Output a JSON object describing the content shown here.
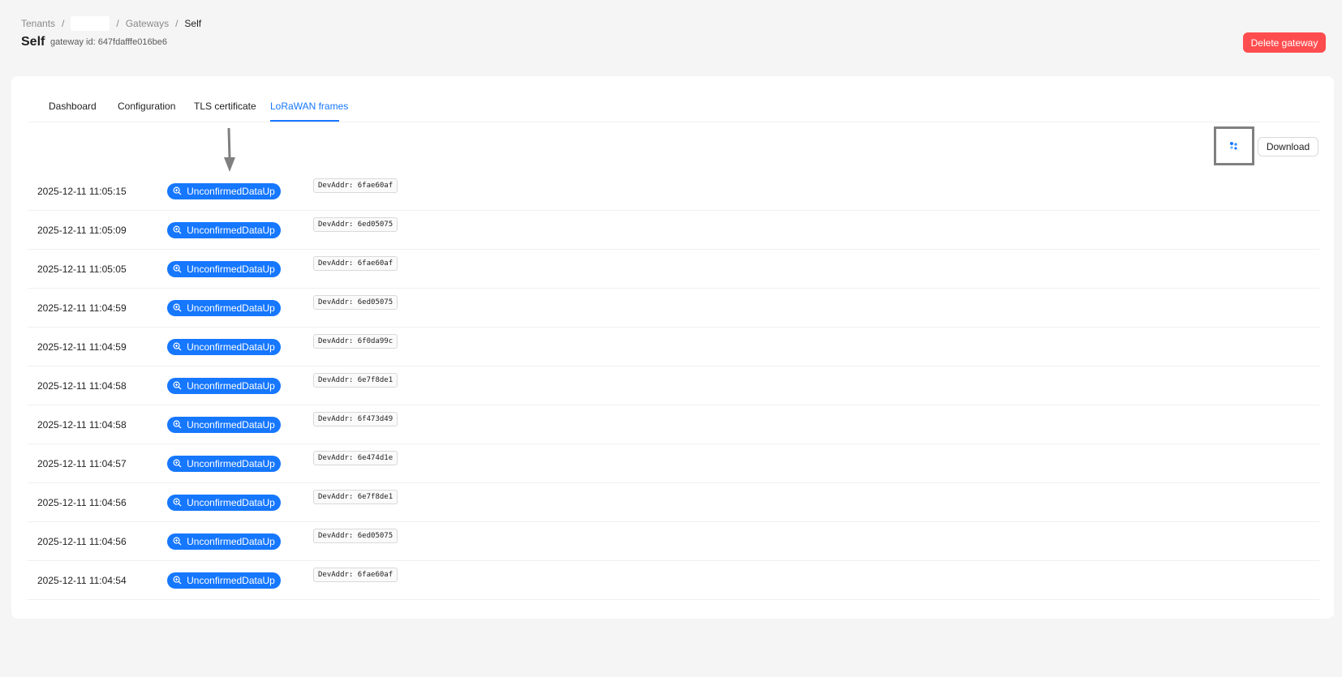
{
  "breadcrumb": {
    "items": [
      "Tenants",
      "",
      "Gateways",
      "Self"
    ],
    "separator": "/"
  },
  "header": {
    "title": "Self",
    "subtitle": "gateway id: 647fdafffe016be6",
    "delete_label": "Delete gateway"
  },
  "tabs": [
    {
      "label": "Dashboard",
      "active": false
    },
    {
      "label": "Configuration",
      "active": false
    },
    {
      "label": "TLS certificate",
      "active": false
    },
    {
      "label": "LoRaWAN frames",
      "active": true
    }
  ],
  "toolbar": {
    "refresh_icon": "loading-dots-icon",
    "download_label": "Download"
  },
  "frames": [
    {
      "time": "2025-12-11 11:05:15",
      "type": "UnconfirmedDataUp",
      "devaddr": "DevAddr: 6fae60af"
    },
    {
      "time": "2025-12-11 11:05:09",
      "type": "UnconfirmedDataUp",
      "devaddr": "DevAddr: 6ed05075"
    },
    {
      "time": "2025-12-11 11:05:05",
      "type": "UnconfirmedDataUp",
      "devaddr": "DevAddr: 6fae60af"
    },
    {
      "time": "2025-12-11 11:04:59",
      "type": "UnconfirmedDataUp",
      "devaddr": "DevAddr: 6ed05075"
    },
    {
      "time": "2025-12-11 11:04:59",
      "type": "UnconfirmedDataUp",
      "devaddr": "DevAddr: 6f0da99c"
    },
    {
      "time": "2025-12-11 11:04:58",
      "type": "UnconfirmedDataUp",
      "devaddr": "DevAddr: 6e7f8de1"
    },
    {
      "time": "2025-12-11 11:04:58",
      "type": "UnconfirmedDataUp",
      "devaddr": "DevAddr: 6f473d49"
    },
    {
      "time": "2025-12-11 11:04:57",
      "type": "UnconfirmedDataUp",
      "devaddr": "DevAddr: 6e474d1e"
    },
    {
      "time": "2025-12-11 11:04:56",
      "type": "UnconfirmedDataUp",
      "devaddr": "DevAddr: 6e7f8de1"
    },
    {
      "time": "2025-12-11 11:04:56",
      "type": "UnconfirmedDataUp",
      "devaddr": "DevAddr: 6ed05075"
    },
    {
      "time": "2025-12-11 11:04:54",
      "type": "UnconfirmedDataUp",
      "devaddr": "DevAddr: 6fae60af"
    }
  ],
  "colors": {
    "primary": "#1677ff",
    "danger": "#ff4d4f",
    "background": "#f5f5f5"
  }
}
